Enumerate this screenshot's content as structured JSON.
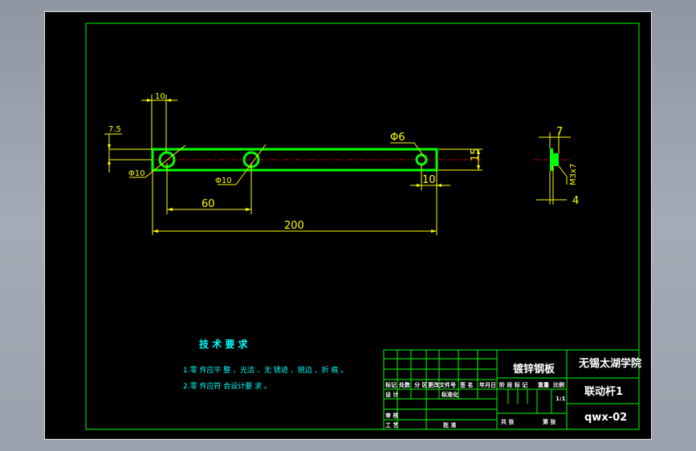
{
  "colors": {
    "background": "#000000",
    "frame": "#00ff00",
    "part": "#00ff00",
    "dimension": "#ffff00",
    "centerline": "#ff0000",
    "text": "#00ffff",
    "titleblock_text": "#ffffff"
  },
  "dimensions": {
    "d_10_top": "10",
    "d_7_5": "7.5",
    "d_phi6": "Φ6",
    "d_phi10_a": "Φ10",
    "d_phi10_b": "Φ10",
    "d_15": "15",
    "d_10_right": "10",
    "d_60": "60",
    "d_200": "200",
    "d_7_side": "7",
    "d_4_side": "4",
    "d_m3": "M3x7"
  },
  "tech_req": {
    "title": "技 术 要 求",
    "item1": "1.零 件应平 整 、光洁 、无 锈迹 、锐边 、折 痕 。",
    "item2": "2.零 件应符 合设计要 求 。"
  },
  "title_block": {
    "material": "镀锌钢板",
    "school": "无锡太湖学院",
    "part_name": "联动杆1",
    "drawing_no": "qwx-02",
    "row_mark": "标记",
    "row_count": "处数",
    "row_zone": "分 区",
    "row_docno": "更改文件号",
    "row_sign": "签 名",
    "row_date": "年月日",
    "design": "设 计",
    "std": "标准化",
    "review": "审 核",
    "process": "工 艺",
    "approve": "批 准",
    "stage_mark": "阶 段 标 记",
    "weight": "重量",
    "scale": "比例",
    "scale_value": "1:1",
    "total": "共 张",
    "sheet": "第 张"
  }
}
